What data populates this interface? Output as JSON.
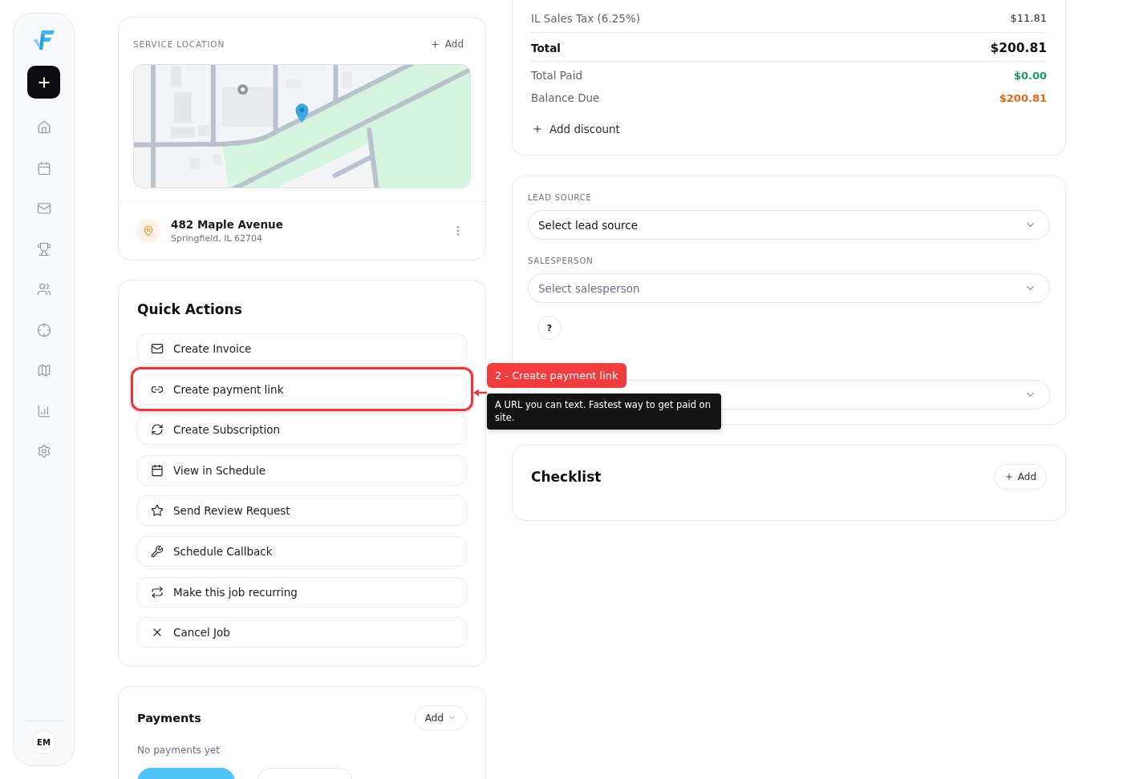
{
  "sidebar": {
    "items": [
      {
        "kind": "home"
      },
      {
        "kind": "calendar"
      },
      {
        "kind": "mail"
      },
      {
        "kind": "trophy"
      },
      {
        "kind": "people"
      },
      {
        "kind": "target"
      },
      {
        "kind": "map"
      },
      {
        "kind": "chart"
      },
      {
        "kind": "settings"
      }
    ],
    "user_initials": "EM"
  },
  "service_location": {
    "title": "SERVICE LOCATION",
    "add_label": "Add",
    "street": "482 Maple Avenue",
    "city": "Springfield, IL 62704"
  },
  "quick_actions": {
    "title": "Quick Actions",
    "items": [
      {
        "label": "Create Invoice",
        "kind": "invoice",
        "highlighted": false
      },
      {
        "label": "Create payment link",
        "kind": "link",
        "highlighted": true
      },
      {
        "label": "Create Subscription",
        "kind": "subscription",
        "highlighted": false
      },
      {
        "label": "View in Schedule",
        "kind": "schedule",
        "highlighted": false
      },
      {
        "label": "Send Review Request",
        "kind": "review",
        "highlighted": false
      },
      {
        "label": "Schedule Callback",
        "kind": "callback",
        "highlighted": false
      },
      {
        "label": "Make this job recurring",
        "kind": "recurring",
        "highlighted": false
      },
      {
        "label": "Cancel Job",
        "kind": "cancel",
        "highlighted": false
      }
    ]
  },
  "callout": {
    "label": "2 - Create payment link",
    "text": "A URL you can text. Fastest way to get paid on site."
  },
  "payments": {
    "title": "Payments",
    "add_label": "Add",
    "empty_text": "No payments yet",
    "actions": [
      {
        "kind": "primary"
      },
      {
        "kind": "secondary"
      }
    ]
  },
  "summary": {
    "rows": [
      {
        "kind": "line",
        "label": "IL Sales Tax (6.25%)",
        "value": "$11.81"
      },
      {
        "kind": "total",
        "label": "Total",
        "value": "$200.81"
      },
      {
        "kind": "paid",
        "label": "Total Paid",
        "value": "$0.00"
      },
      {
        "kind": "due",
        "label": "Balance Due",
        "value": "$200.81"
      }
    ],
    "add_discount_label": "Add discount"
  },
  "lead_form": {
    "fields": [
      {
        "kind": "select",
        "label": "LEAD SOURCE",
        "value": "Select lead source"
      },
      {
        "kind": "select",
        "label": "SALESPERSON",
        "placeholder": "Select salesperson"
      },
      {
        "kind": "help",
        "label": "?"
      },
      {
        "kind": "select"
      }
    ]
  },
  "checklist": {
    "title": "Checklist",
    "add_label": "Add"
  }
}
